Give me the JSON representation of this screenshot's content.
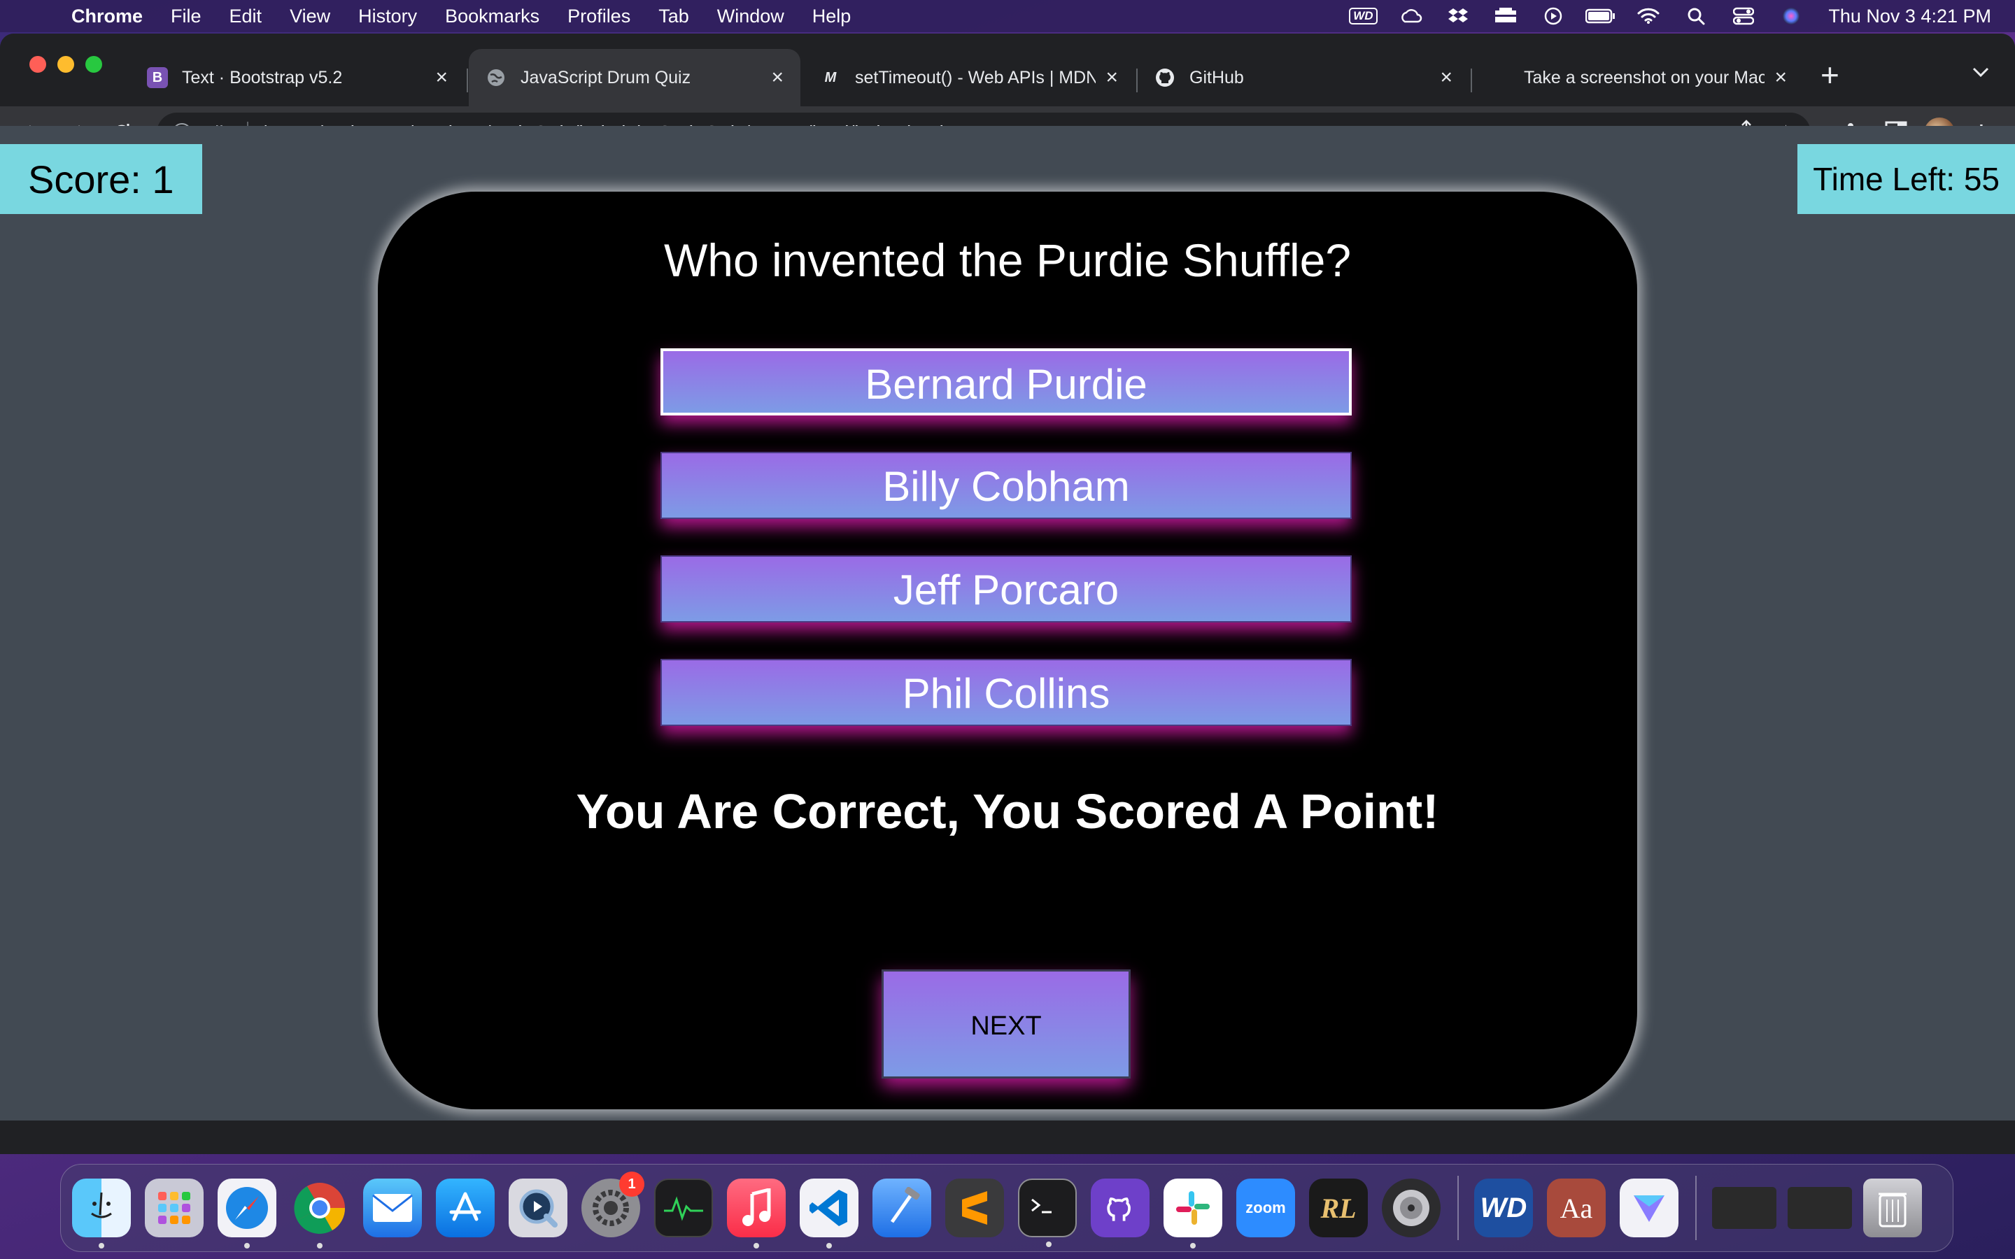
{
  "menubar": {
    "apple_glyph": "",
    "app_name": "Chrome",
    "items": [
      "File",
      "Edit",
      "View",
      "History",
      "Bookmarks",
      "Profiles",
      "Tab",
      "Window",
      "Help"
    ],
    "wd_label": "WD",
    "clock": "Thu Nov 3  4:21 PM"
  },
  "browser": {
    "tabs": [
      {
        "title": "Text · Bootstrap v5.2",
        "favicon_letter": "B",
        "favicon_color": "#7952b3"
      },
      {
        "title": "JavaScript Drum Quiz",
        "active": true
      },
      {
        "title": "setTimeout() - Web APIs | MDN",
        "favicon_letter": "M"
      },
      {
        "title": "GitHub"
      },
      {
        "title": "Take a screenshot on your Mac"
      }
    ],
    "address": {
      "scheme_label": "File",
      "url": "/Users/carlsagan/Desktop/codeQuiz/jerimiahsCodeQuiz/assets/html/index.html"
    }
  },
  "quiz": {
    "score_label": "Score: 1",
    "timer_label": "Time Left: 55",
    "question": "Who invented the Purdie Shuffle?",
    "answers": [
      "Bernard Purdie",
      "Billy Cobham",
      "Jeff Porcaro",
      "Phil Collins"
    ],
    "feedback": "You Are Correct, You Scored A Point!",
    "next_label": "NEXT",
    "colors": {
      "button_gradient_top": "#9a6be6",
      "button_gradient_bottom": "#7d9be6",
      "glow": "#e61eb4",
      "badge_bg": "#79d7e0",
      "page_bg": "#424a53"
    }
  },
  "dock": {
    "apps": [
      "finder-icon",
      "launchpad-icon",
      "safari-icon",
      "chrome-icon",
      "mail-icon",
      "app-store-icon",
      "quicktime-icon",
      "system-preferences-icon",
      "activity-monitor-icon",
      "music-icon",
      "vscode-icon",
      "xcode-icon",
      "sublime-text-icon",
      "terminal-icon",
      "github-desktop-icon",
      "slack-icon",
      "zoom-icon",
      "rl-app-icon",
      "logic-icon",
      "wd-discovery-icon",
      "dictionary-icon",
      "prisma-icon"
    ],
    "system_prefs_badge": "1",
    "zoom_label": "zoom",
    "wd_label": "WD",
    "dictionary_label": "Aa",
    "rl_label": "RL"
  }
}
